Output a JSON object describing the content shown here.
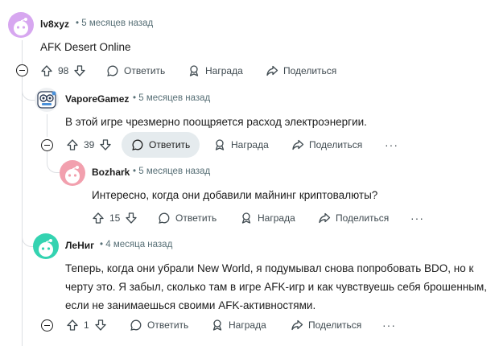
{
  "comments": [
    {
      "author": "lv8xyz",
      "time": "5 месяцев назад",
      "text": "AFK Desert Online",
      "votes": "98",
      "reply_label": "Ответить",
      "award_label": "Награда",
      "share_label": "Поделиться",
      "avatar_color": "#d7a7f0"
    },
    {
      "author": "VaporeGamez",
      "time": "5 месяцев назад",
      "text": "В этой игре чрезмерно поощряется расход электроэнергии.",
      "votes": "39",
      "reply_label": "Ответить",
      "award_label": "Награда",
      "share_label": "Поделиться"
    },
    {
      "author": "Bozhark",
      "time": "5 месяцев назад",
      "text": "Интересно, когда они добавили майнинг криптовалюты?",
      "votes": "15",
      "reply_label": "Ответить",
      "award_label": "Награда",
      "share_label": "Поделиться",
      "avatar_color": "#f2a0ae"
    },
    {
      "author": "ЛеНиг",
      "time": "4 месяца назад",
      "text_lines": [
        "Теперь, когда они убрали New World, я подумывал снова попробовать BDO, но к",
        "черту это. Я забыл, сколько там в игре AFK-игр и как чувствуешь себя брошенным,",
        "если не занимаешься своими AFK-активностями."
      ],
      "votes": "1",
      "reply_label": "Ответить",
      "award_label": "Награда",
      "share_label": "Поделиться",
      "avatar_color": "#34d3b1"
    }
  ],
  "separator": "•",
  "more_label": "···"
}
